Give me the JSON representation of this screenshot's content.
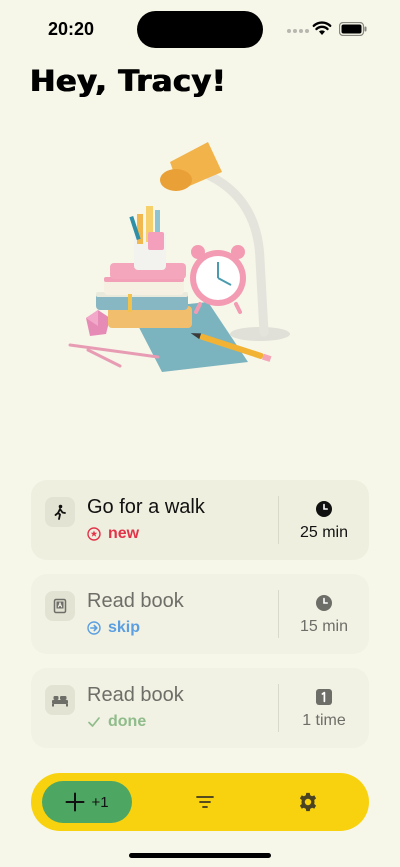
{
  "status_bar": {
    "time": "20:20"
  },
  "greeting": "Hey, Tracy!",
  "tasks": [
    {
      "title": "Go for a walk",
      "icon": "walking-person-icon",
      "status": "new",
      "status_icon": "star-circle-icon",
      "status_color": "#e3334a",
      "meta_icon": "clock-icon",
      "meta_value": "25 min",
      "active": true
    },
    {
      "title": "Read book",
      "icon": "book-icon",
      "status": "skip",
      "status_icon": "arrow-circle-icon",
      "status_color": "#5b9fe0",
      "meta_icon": "clock-icon",
      "meta_value": "15 min",
      "active": false
    },
    {
      "title": "Read book",
      "icon": "bed-icon",
      "status": "done",
      "status_icon": "checkmark-icon",
      "status_color": "#8fbc8a",
      "meta_icon": "count-1-icon",
      "meta_value": "1 time",
      "active": false
    }
  ],
  "toolbar": {
    "add_label": "+1",
    "add_icon": "plus-icon",
    "filter_icon": "filter-lines-icon",
    "settings_icon": "gear-icon",
    "accent_color": "#f8d20e",
    "add_color": "#4ea663"
  }
}
